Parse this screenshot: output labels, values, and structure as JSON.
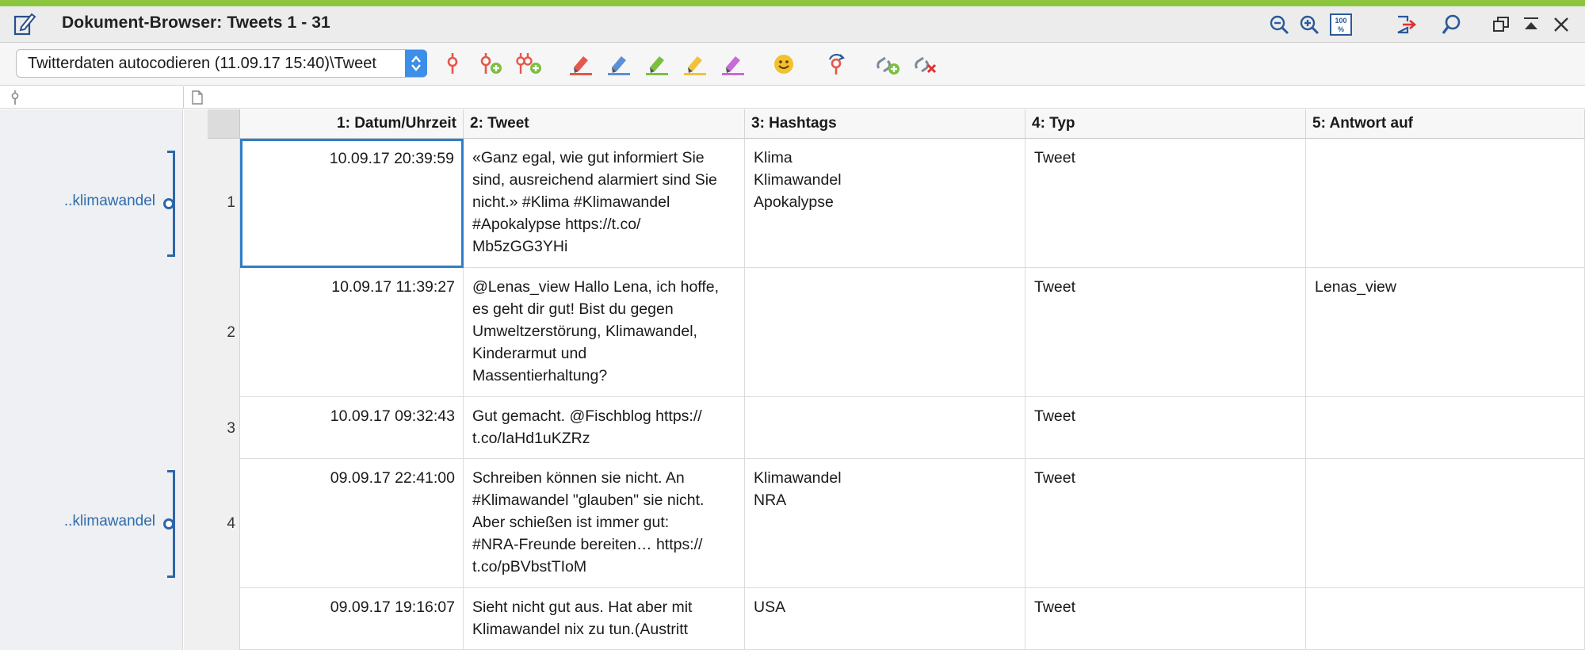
{
  "window": {
    "title": "Dokument-Browser: Tweets 1 - 31",
    "accent_color": "#8cc63f",
    "title_icons": [
      "zoom-out-icon",
      "zoom-in-icon",
      "zoom-100-icon",
      "export-icon",
      "search-icon",
      "restore-window-icon",
      "collapse-icon",
      "close-icon"
    ]
  },
  "toolbar": {
    "document_select": "Twitterdaten autocodieren (11.09.17 15:40)\\Tweet",
    "tools": [
      "code-icon",
      "code-add-icon",
      "code-multi-add-icon",
      "highlighter-red-icon",
      "highlighter-blue-icon",
      "highlighter-green-icon",
      "highlighter-yellow-icon",
      "highlighter-purple-icon",
      "emoticon-icon",
      "code-undo-icon",
      "link-add-icon",
      "link-remove-icon"
    ],
    "highlighter_colors": [
      "#e4574a",
      "#5b8fd8",
      "#7bbf3f",
      "#f0c23a",
      "#c76bd6"
    ]
  },
  "coding": [
    {
      "label": "..klimawandel",
      "row": 1
    },
    {
      "label": "..klimawandel",
      "row": 4
    }
  ],
  "table": {
    "columns": [
      "1: Datum/Uhrzeit",
      "2: Tweet",
      "3: Hashtags",
      "4: Typ",
      "5: Antwort auf"
    ],
    "rows": [
      {
        "num": "1",
        "datum": "10.09.17 20:39:59",
        "tweet": "«Ganz egal, wie gut informiert Sie\nsind, ausreichend alarmiert sind Sie\nnicht.» #Klima #Klimawandel\n#Apokalypse https://t.co/\nMb5zGG3YHi",
        "hashtags": "Klima\nKlimawandel\nApokalypse",
        "typ": "Tweet",
        "antwort": ""
      },
      {
        "num": "2",
        "datum": "10.09.17 11:39:27",
        "tweet": "@Lenas_view Hallo Lena, ich hoffe,\nes geht dir gut! Bist du gegen\nUmweltzerstörung, Klimawandel,\nKinderarmut und\nMassentierhaltung?",
        "hashtags": "",
        "typ": "Tweet",
        "antwort": "Lenas_view"
      },
      {
        "num": "3",
        "datum": "10.09.17 09:32:43",
        "tweet": "Gut gemacht. @Fischblog  https://\nt.co/IaHd1uKZRz",
        "hashtags": "",
        "typ": "Tweet",
        "antwort": ""
      },
      {
        "num": "4",
        "datum": "09.09.17 22:41:00",
        "tweet": "Schreiben können sie nicht. An\n#Klimawandel \"glauben\" sie nicht.\nAber schießen ist immer gut:\n#NRA-Freunde bereiten… https://\nt.co/pBVbstTIoM",
        "hashtags": "Klimawandel\nNRA",
        "typ": "Tweet",
        "antwort": ""
      },
      {
        "num": "",
        "datum": "09.09.17 19:16:07",
        "tweet": "Sieht nicht gut aus. Hat aber mit\nKlimawandel nix zu tun.(Austritt",
        "hashtags": "USA",
        "typ": "Tweet",
        "antwort": ""
      }
    ]
  }
}
